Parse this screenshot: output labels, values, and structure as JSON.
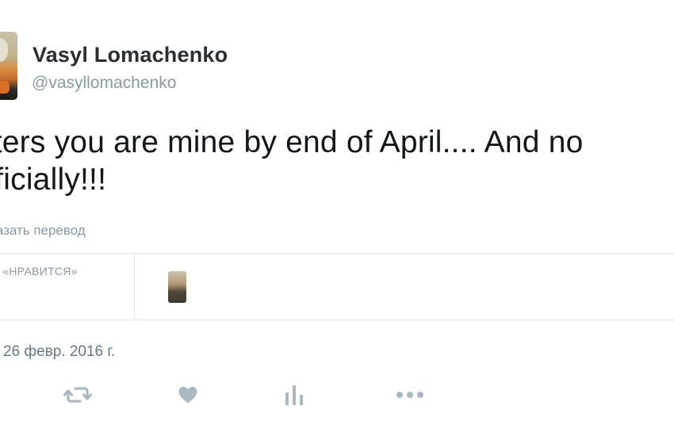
{
  "tweet": {
    "author": {
      "display_name": "Vasyl Lomachenko",
      "username": "@vasyllomachenko"
    },
    "text_line1": "alters you are mine by end of April.... And no",
    "text_line2": "officially!!!",
    "translate_link": "казать перевод",
    "likes_label": "ТКА «НРАВИТСЯ»",
    "timestamp": "26 февр. 2016 г."
  },
  "actions": [
    {
      "name": "retweet",
      "icon": "retweet-icon"
    },
    {
      "name": "like",
      "icon": "heart-icon"
    },
    {
      "name": "analytics",
      "icon": "bar-chart-icon"
    },
    {
      "name": "more",
      "icon": "more-dots-icon"
    }
  ],
  "colors": {
    "text": "#14171a",
    "secondary": "#8899a6",
    "icon": "#aab8c2",
    "divider": "#e1e8ed"
  }
}
